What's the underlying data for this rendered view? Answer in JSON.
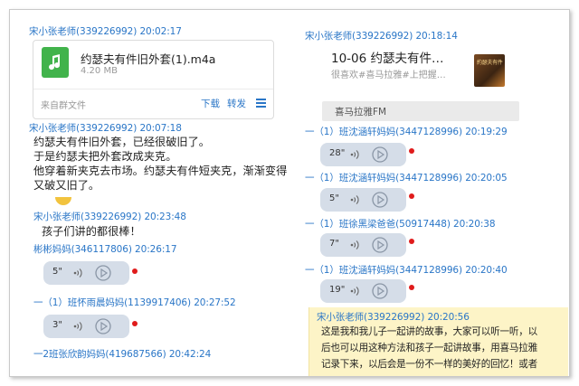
{
  "left": {
    "m1_sender": "宋小张老师(339226992) 20:02:17",
    "file": {
      "name": "约瑟夫有件旧外套(1).m4a",
      "size": "4.20 MB",
      "source": "来自群文件",
      "download": "下载",
      "forward": "转发"
    },
    "m2_sender": "宋小张老师(339226992) 20:07:18",
    "m2_lines": [
      "约瑟夫有件旧外套，已经很破旧了。",
      "于是约瑟夫把外套改成夹克。",
      "他穿着新夹克去市场。约瑟夫有件短夹克，渐渐变得",
      "又破又旧了。"
    ],
    "m3_sender": "宋小张老师(339226992) 20:23:48",
    "m3_text": "孩子们讲的都很棒！",
    "m4_sender": "彬彬妈妈(346117806) 20:26:17",
    "m4_seconds": "5\"",
    "m5_sender": "一（1）班怀雨晨妈妈(1139917406) 20:27:52",
    "m5_seconds": "3\"",
    "m6_sender": "一2班张欣韵妈妈(419687566) 20:42:24"
  },
  "right": {
    "m1_sender": "宋小张老师(339226992) 20:18:14",
    "music": {
      "title": "10-06 约瑟夫有件…",
      "subtitle": "很喜欢#喜马拉雅#上把握…",
      "cover_text": "約瑟夫有件",
      "platform": "喜马拉雅FM"
    },
    "voices": [
      {
        "sender": "一（1）班沈涵轩妈妈(3447128996) 20:19:29",
        "seconds": "28\""
      },
      {
        "sender": "一（1）班沈涵轩妈妈(3447128996) 20:20:05",
        "seconds": "5\""
      },
      {
        "sender": "一（1）班徐黑梁爸爸(50917448) 20:20:38",
        "seconds": "7\""
      },
      {
        "sender": "一（1）班沈涵轩妈妈(3447128996) 20:20:40",
        "seconds": "19\""
      }
    ],
    "last_sender": "宋小张老师(339226992) 20:20:56",
    "last_lines": [
      "这是我和我儿子一起讲的故事，大家可以听一听，以",
      "后也可以用这种方法和孩子一起讲故事，用喜马拉雅",
      "记录下来，以后会是一份不一样的美好的回忆！或者"
    ]
  },
  "colors": {
    "sender": "#2a76c7",
    "voice_bubble": "#d5dde8",
    "unread_dot": "#e01b1b",
    "highlight": "#fdf4c7"
  }
}
